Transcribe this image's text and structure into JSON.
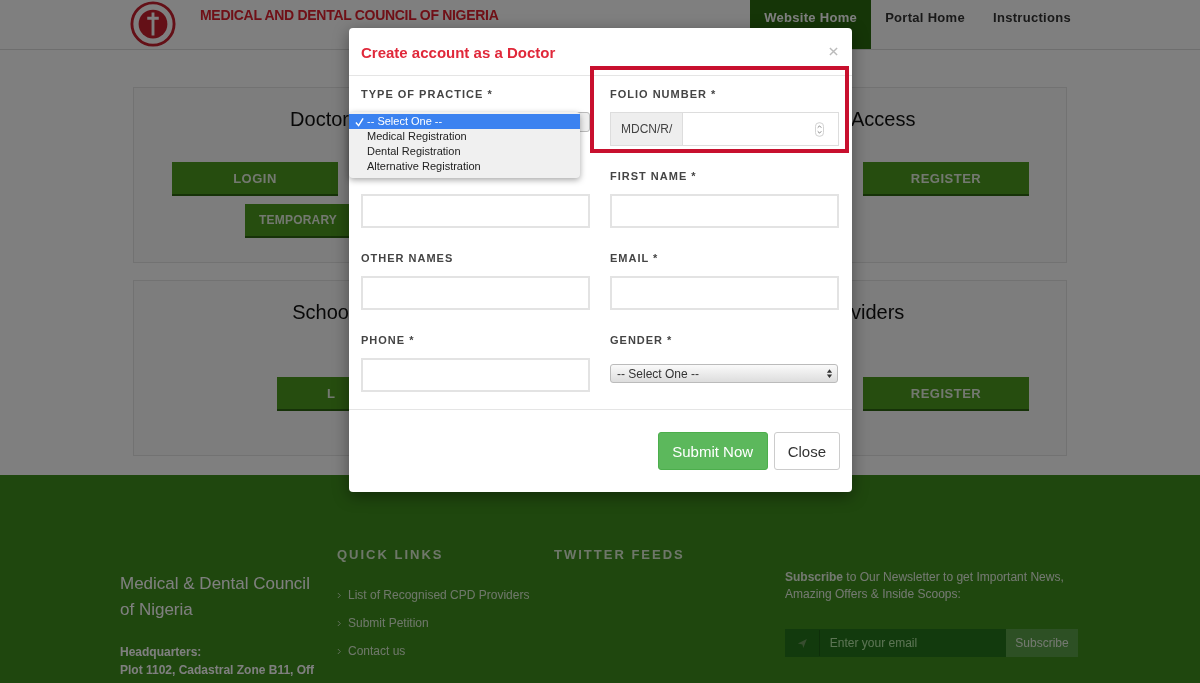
{
  "header": {
    "title": "MEDICAL AND DENTAL COUNCIL OF NIGERIA",
    "nav": [
      {
        "label": "Website Home",
        "selected": true
      },
      {
        "label": "Portal Home",
        "selected": false
      },
      {
        "label": "Instructions",
        "selected": false
      }
    ]
  },
  "panels": [
    {
      "left_title": "Doctor",
      "right_title": "Access",
      "left_buttons": [
        "LOGIN",
        "TEMPORARY"
      ],
      "right_buttons": [
        "REGISTER"
      ]
    },
    {
      "left_title": "Schoo",
      "right_title": "viders",
      "left_buttons": [
        "L"
      ],
      "right_buttons": [
        "REGISTER"
      ]
    }
  ],
  "modal": {
    "title": "Create account as a Doctor",
    "practice": {
      "label": "TYPE OF PRACTICE *",
      "options": [
        {
          "label": "-- Select One --",
          "selected": true
        },
        {
          "label": "Medical Registration",
          "selected": false
        },
        {
          "label": "Dental Registration",
          "selected": false
        },
        {
          "label": "Alternative Registration",
          "selected": false
        }
      ]
    },
    "folio": {
      "label": "FOLIO NUMBER *",
      "prefix": "MDCN/R/",
      "highlighted": true
    },
    "fields": [
      {
        "kind": "text"
      },
      {
        "label": "FIRST NAME *",
        "kind": "text"
      },
      {
        "label": "OTHER NAMES",
        "kind": "text"
      },
      {
        "label": "EMAIL *",
        "kind": "text"
      },
      {
        "label": "PHONE *",
        "kind": "text"
      },
      {
        "label": "GENDER *",
        "kind": "select",
        "value": "-- Select One --"
      }
    ],
    "buttons": [
      {
        "label": "Submit Now",
        "kind": "primary"
      },
      {
        "label": "Close",
        "kind": "default"
      }
    ]
  },
  "footer": {
    "org": "Medical & Dental Council of Nigeria",
    "hq_label": "Headquarters:",
    "address": "Plot 1102, Cadastral Zone B11, Off",
    "quick_links_title": "QUICK LINKS",
    "quick_links": [
      "List of Recognised CPD Providers",
      "Submit Petition",
      "Contact us"
    ],
    "twitter_title": "TWITTER FEEDS",
    "newsletter": "**Subscribe** to Our Newsletter to get Important News, Amazing Offers & Inside Scoops:",
    "email_placeholder": "Enter your email",
    "subscribe_button": "Subscribe"
  }
}
